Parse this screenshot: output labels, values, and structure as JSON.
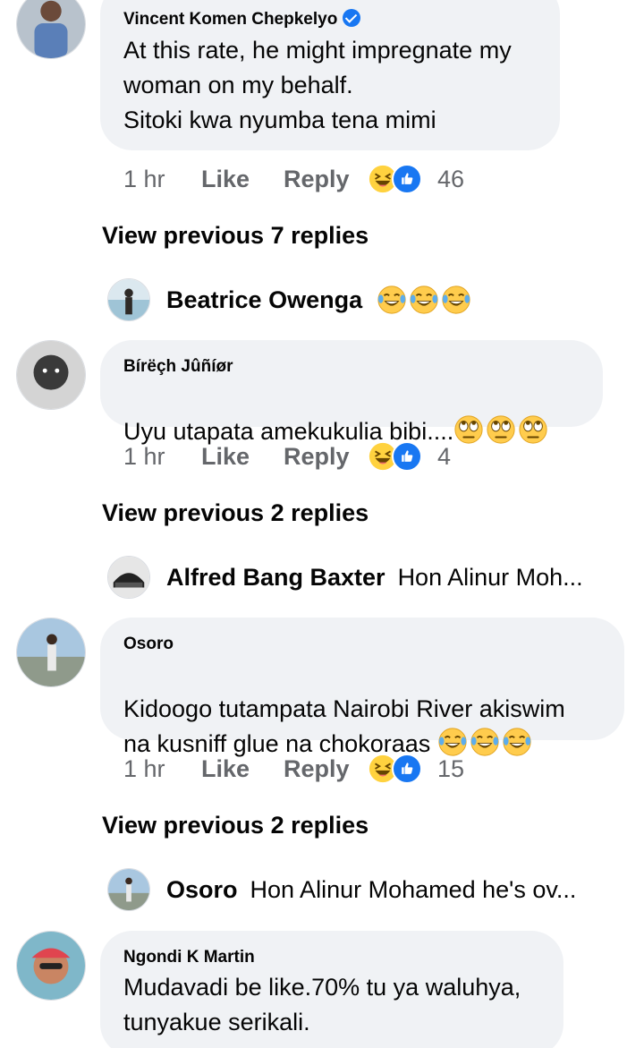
{
  "comments": [
    {
      "author": "Vincent Komen Chepkelyo",
      "text": "At this rate, he might impregnate my\nwoman on my behalf.\nSitoki kwa nyumba tena mimi",
      "time": "1 hr",
      "like_label": "Like",
      "reply_label": "Reply",
      "reaction_count": "46"
    },
    {
      "author": "Bírëçh Jûñíør",
      "text": "Uyu utapata amekukulia bibi....",
      "time": "1 hr",
      "like_label": "Like",
      "reply_label": "Reply",
      "reaction_count": "4"
    },
    {
      "author": "Osoro",
      "text_line1": "Kidoogo tutampata Nairobi River akiswim",
      "text_line2": "na kusniff glue na chokoraas",
      "time": "1 hr",
      "like_label": "Like",
      "reply_label": "Reply",
      "reaction_count": "15"
    },
    {
      "author": "Ngondi K Martin",
      "text": "Mudavadi be like.70% tu ya waluhya,\ntunyakue serikali."
    }
  ],
  "view_previous": [
    "View previous 7 replies",
    "View previous 2 replies",
    "View previous 2 replies"
  ],
  "sub_replies": [
    {
      "name": "Beatrice Owenga",
      "preview": ""
    },
    {
      "name": "Alfred Bang Baxter",
      "preview": "Hon Alinur Moh..."
    },
    {
      "name": "Osoro",
      "preview": "Hon Alinur Mohamed he's ov..."
    }
  ],
  "icons": {
    "verified": "verified-badge-icon",
    "haha": "haha-reaction-icon",
    "like": "like-reaction-icon",
    "crying_laughing": "face-with-tears-of-joy-icon",
    "eye_roll": "face-with-rolling-eyes-icon"
  },
  "colors": {
    "bubble": "#f0f2f5",
    "secondary_text": "#65676b",
    "fb_blue": "#1877f2"
  }
}
